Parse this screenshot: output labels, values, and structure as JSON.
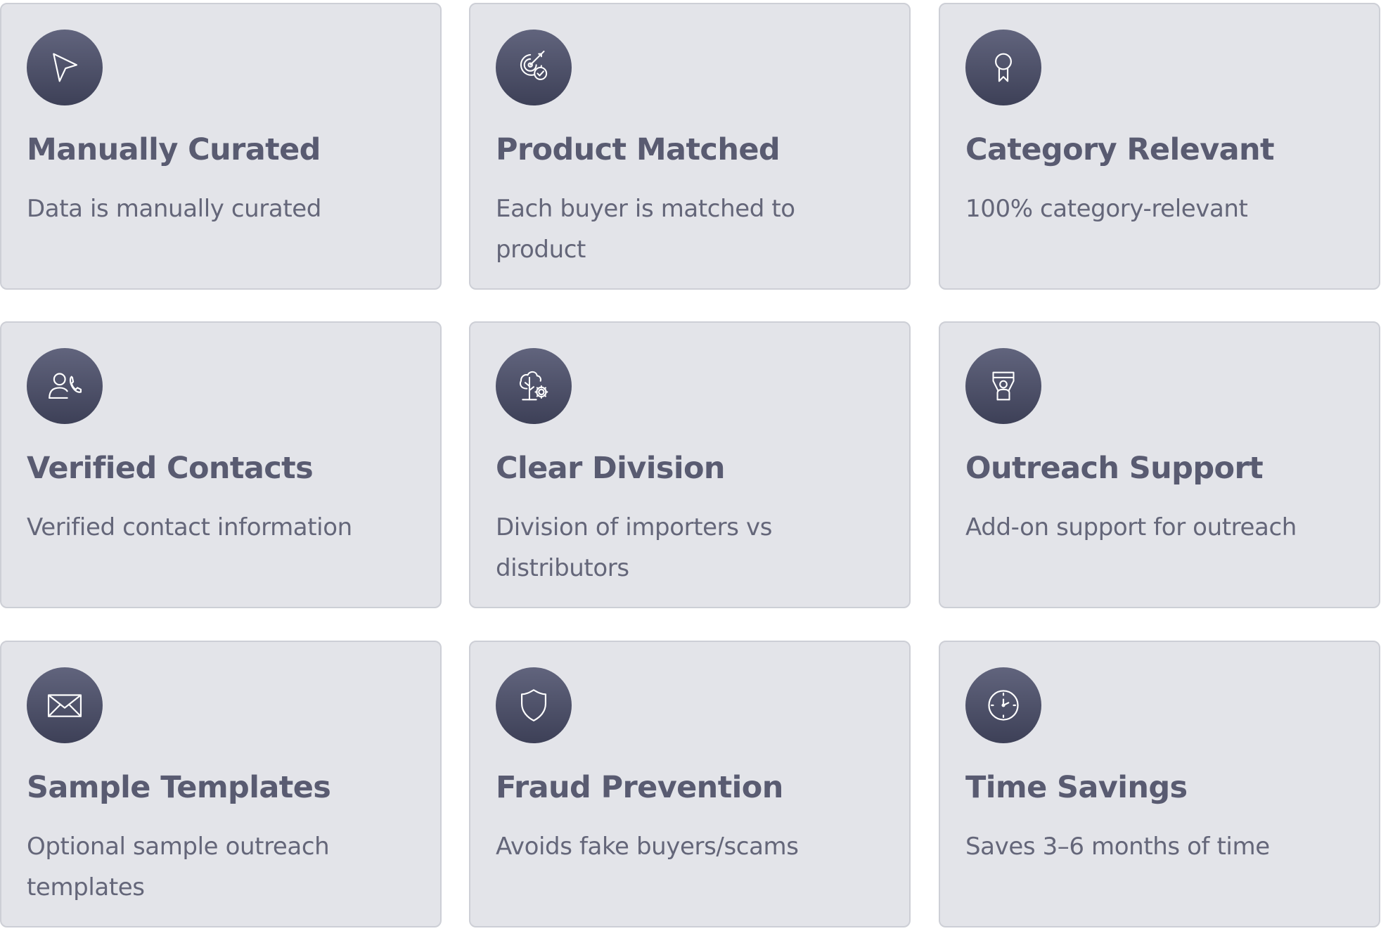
{
  "cards": [
    {
      "title": "Manually Curated",
      "description": "Data is manually curated",
      "icon": "cursor-arrow-icon"
    },
    {
      "title": "Product Matched",
      "description": "Each buyer is matched to product",
      "icon": "target-check-icon"
    },
    {
      "title": "Category Relevant",
      "description": "100% category-relevant",
      "icon": "award-ribbon-icon"
    },
    {
      "title": "Verified Contacts",
      "description": "Verified contact information",
      "icon": "user-phone-icon"
    },
    {
      "title": "Clear Division",
      "description": "Division of importers vs distributors",
      "icon": "tree-gear-icon"
    },
    {
      "title": "Outreach Support",
      "description": "Add-on support for outreach",
      "icon": "person-banner-icon"
    },
    {
      "title": "Sample Templates",
      "description": "Optional sample outreach templates",
      "icon": "envelope-icon"
    },
    {
      "title": "Fraud Prevention",
      "description": "Avoids fake buyers/scams",
      "icon": "shield-icon"
    },
    {
      "title": "Time Savings",
      "description": "Saves 3–6 months of time",
      "icon": "clock-icon"
    }
  ],
  "colors": {
    "card_background": "#e3e4e9",
    "card_border": "#cdcfd6",
    "icon_circle": "#4c4f67",
    "title_text": "#595b71",
    "description_text": "#646679"
  }
}
